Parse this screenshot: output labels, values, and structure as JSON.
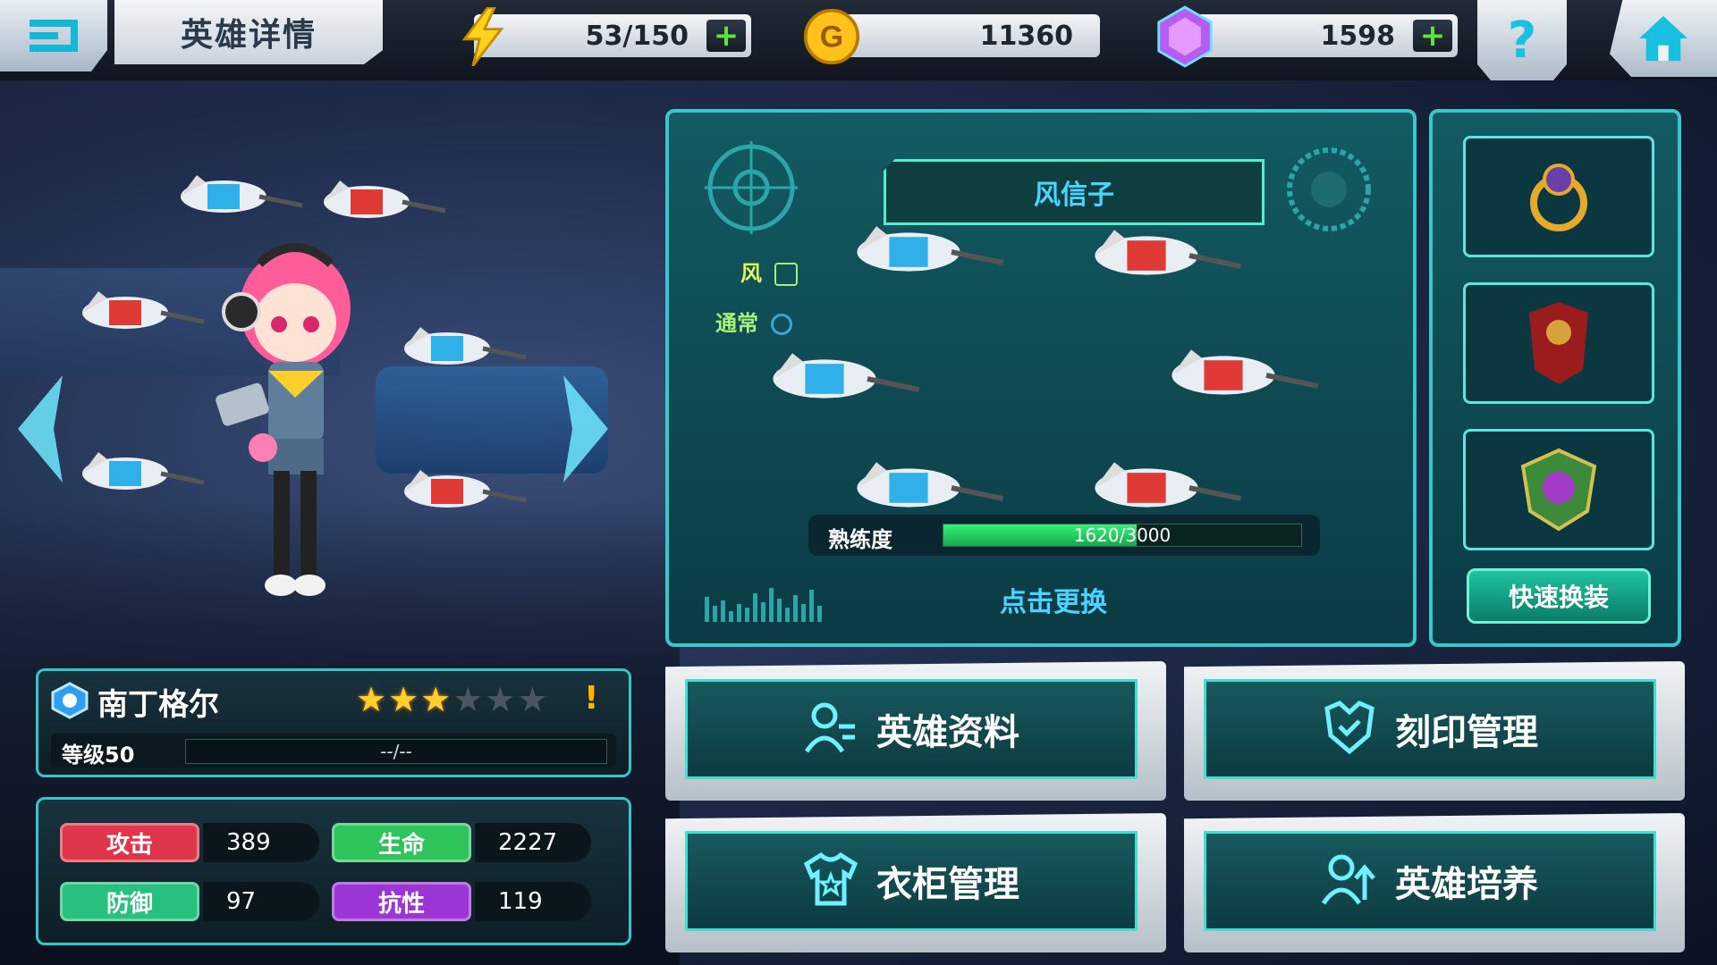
{
  "header": {
    "title": "英雄详情",
    "energy": "53/150",
    "gold": "11360",
    "gems": "1598",
    "help_label": "?"
  },
  "hero": {
    "name": "南丁格尔",
    "stars_total": 6,
    "stars_filled": 3,
    "warning": "!",
    "level_label": "等级50",
    "exp_text": "--/--"
  },
  "stats": [
    {
      "label": "攻击",
      "value": "389",
      "color": "#e0364c"
    },
    {
      "label": "生命",
      "value": "2227",
      "color": "#2fc35c"
    },
    {
      "label": "防御",
      "value": "97",
      "color": "#27c07f"
    },
    {
      "label": "抗性",
      "value": "119",
      "color": "#9b35d6"
    }
  ],
  "weapon": {
    "name": "风信子",
    "element": "风",
    "attack_type": "通常",
    "mastery_label": "熟练度",
    "mastery_text": "1620/3000",
    "mastery_progress": 0.54,
    "change_label": "点击更换"
  },
  "equipment": {
    "slots": [
      "ring",
      "armor",
      "emblem"
    ],
    "quick_change_label": "快速换装"
  },
  "menu": {
    "hero_profile": "英雄资料",
    "imprint_manage": "刻印管理",
    "wardrobe_manage": "衣柜管理",
    "hero_train": "英雄培养"
  },
  "colors": {
    "panel_border": "#37c9c9",
    "accent_cyan": "#46d6ff",
    "progress_green": "#36f07a"
  }
}
